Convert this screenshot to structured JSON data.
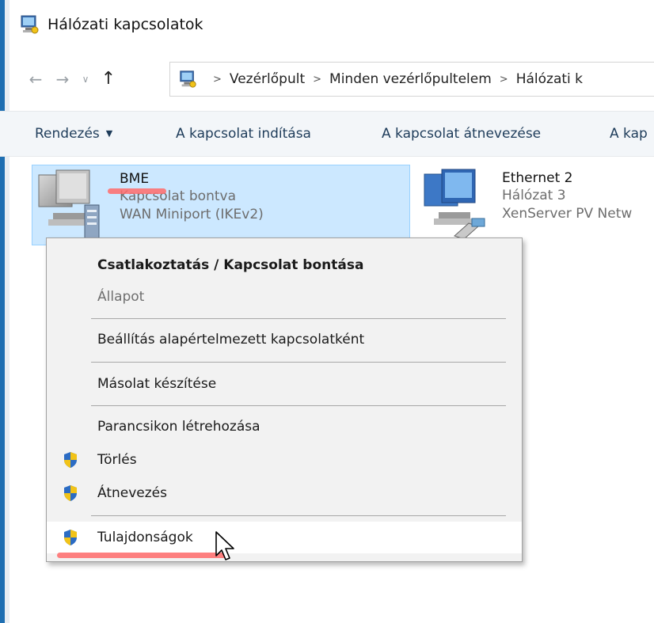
{
  "window": {
    "title": "Hálózati kapcsolatok"
  },
  "nav": {
    "back_icon": "back-arrow-icon",
    "forward_icon": "forward-arrow-icon",
    "recent_icon": "chevron-down-icon",
    "up_icon": "up-arrow-icon"
  },
  "address": {
    "crumbs": [
      "Vezérlőpult",
      "Minden vezérlőpultelem",
      "Hálózati k"
    ]
  },
  "commands": {
    "organize": "Rendezés",
    "start": "A kapcsolat indítása",
    "rename": "A kapcsolat átnevezése",
    "more": "A kap"
  },
  "items": [
    {
      "name": "BME",
      "status": "Kapcsolat bontva",
      "device": "WAN Miniport (IKEv2)"
    },
    {
      "name": "Ethernet 2",
      "status": "Hálózat 3",
      "device": "XenServer PV Netw"
    }
  ],
  "menu": {
    "connect": "Csatlakoztatás / Kapcsolat bontása",
    "status": "Állapot",
    "set_default": "Beállítás alapértelmezett kapcsolatként",
    "copy": "Másolat készítése",
    "shortcut": "Parancsikon létrehozása",
    "delete": "Törlés",
    "rename": "Átnevezés",
    "properties": "Tulajdonságok"
  },
  "colors": {
    "selection": "#cce8ff",
    "selection_border": "#99d1ff",
    "annotation": "#ff6b6b",
    "accent": "#1f6fb2"
  }
}
